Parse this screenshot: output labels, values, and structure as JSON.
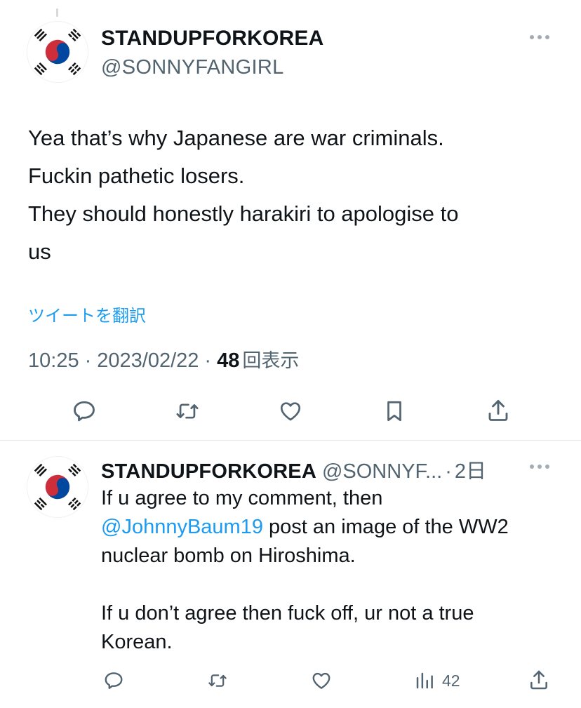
{
  "main_tweet": {
    "display_name": "STANDUPFORKOREA",
    "handle": "@SONNYFANGIRL",
    "text_lines": [
      "Yea that’s why Japanese are war criminals.",
      "Fuckin pathetic losers.",
      "They should honestly harakiri to apologise to",
      "us"
    ],
    "translate_link": "ツイートを翻訳",
    "time": "10:25",
    "separator": "·",
    "date": "2023/02/22",
    "view_count": "48",
    "views_label": "回表示",
    "actions": [
      "reply-icon",
      "retweet-icon",
      "like-icon",
      "bookmark-icon",
      "share-icon"
    ]
  },
  "reply_tweet": {
    "display_name": "STANDUPFORKOREA",
    "handle": "@SONNYF...",
    "separator": "·",
    "age": "2日",
    "line1": "If u agree to my comment, then",
    "mention": "@JohnnyBaum19",
    "line2_rest": " post an image of the WW2",
    "line3": "nuclear bomb on Hiroshima.",
    "line4": "If u don’t agree then fuck off, ur not a true",
    "line5": "Korean.",
    "view_count": "42",
    "actions": [
      "reply-icon",
      "retweet-icon",
      "like-icon",
      "analytics-icon",
      "share-icon"
    ]
  },
  "colors": {
    "text": "#0f1419",
    "secondary": "#536471",
    "link": "#1d9bf0",
    "flag_red": "#cd2e3a",
    "flag_blue": "#0047a0"
  }
}
